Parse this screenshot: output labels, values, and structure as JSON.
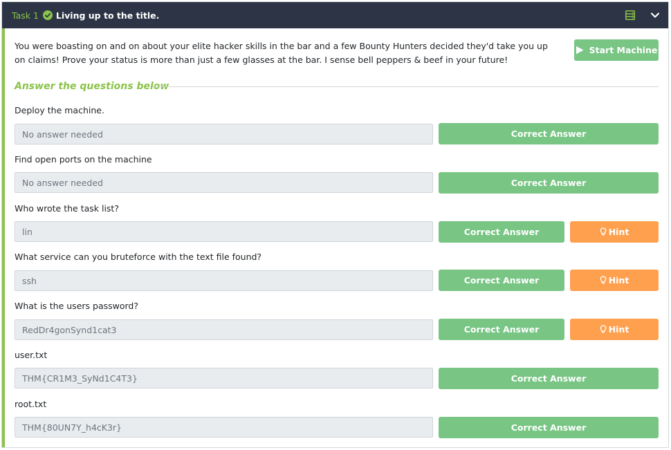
{
  "header": {
    "task_label": "Task 1",
    "title": "Living up to the title.",
    "icons": [
      "check-circle-icon",
      "stack-icon",
      "chevron-down-icon"
    ]
  },
  "intro": {
    "text": "You were boasting on and on about your elite hacker skills in the bar and a few Bounty Hunters decided they'd take you up on claims! Prove your status is more than just a few glasses at the bar. I sense bell peppers & beef in your future!"
  },
  "start_button": {
    "label": "Start Machine",
    "icon": "play-icon"
  },
  "answers_heading": "Answer the questions below",
  "questions": [
    {
      "question": "Deploy the machine.",
      "answer": "No answer needed",
      "button": "Correct Answer",
      "hint": ""
    },
    {
      "question": "Find open ports on the machine",
      "answer": "No answer needed",
      "button": "Correct Answer",
      "hint": ""
    },
    {
      "question": "Who wrote the task list?",
      "answer": "lin",
      "button": "Correct Answer",
      "hint": "Hint"
    },
    {
      "question": "What service can you bruteforce with the text file found?",
      "answer": "ssh",
      "button": "Correct Answer",
      "hint": "Hint"
    },
    {
      "question": "What is the users password?",
      "answer": "RedDr4gonSynd1cat3",
      "button": "Correct Answer",
      "hint": "Hint"
    },
    {
      "question": "user.txt",
      "answer": "THM{CR1M3_SyNd1C4T3}",
      "button": "Correct Answer",
      "hint": ""
    },
    {
      "question": "root.txt",
      "answer": "THM{80UN7Y_h4cK3r}",
      "button": "Correct Answer",
      "hint": ""
    }
  ],
  "colors": {
    "header_bg": "#2c3445",
    "accent_green": "#8bc34a",
    "button_green": "#78c584",
    "hint_orange": "#ffa04f"
  }
}
